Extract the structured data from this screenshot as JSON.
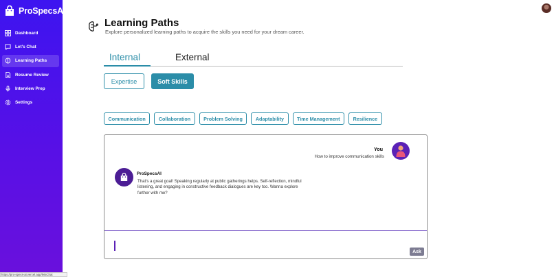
{
  "app": {
    "name": "ProSpecsAI"
  },
  "sidebar": {
    "items": [
      {
        "label": "Dashboard",
        "icon": "dashboard-icon",
        "active": false
      },
      {
        "label": "Let's Chat",
        "icon": "chat-icon",
        "active": false
      },
      {
        "label": "Learning Paths",
        "icon": "brain-icon",
        "active": true
      },
      {
        "label": "Resume Review",
        "icon": "document-icon",
        "active": false
      },
      {
        "label": "Interview Prep",
        "icon": "microphone-icon",
        "active": false
      },
      {
        "label": "Settings",
        "icon": "gear-icon",
        "active": false
      }
    ]
  },
  "status_bar": {
    "url": "https://pro-specs-ai.vercel.app/letsChat"
  },
  "header": {
    "title": "Learning Paths",
    "subtitle": "Explore personalized learning paths to acquire the skills you need for your dream career."
  },
  "tabs": [
    {
      "label": "Internal",
      "active": true
    },
    {
      "label": "External",
      "active": false
    }
  ],
  "categories": [
    {
      "label": "Expertise",
      "selected": false
    },
    {
      "label": "Soft Skills",
      "selected": true
    }
  ],
  "skills": [
    "Communication",
    "Collaboration",
    "Problem Solving",
    "Adaptability",
    "Time Management",
    "Resilience"
  ],
  "chat": {
    "user": {
      "name": "You",
      "message": "How to improve communication skills"
    },
    "bot": {
      "name": "ProSpecsAI",
      "message": "That's a great goal! Speaking regularly at public gatherings helps. Self-reflection, mindful listening, and engaging in constructive feedback dialogues are key too. Wanna explore further with me?"
    },
    "input_value": "",
    "ask_label": "Ask"
  },
  "colors": {
    "sidebar_start": "#3d14f0",
    "sidebar_end": "#6a10dc",
    "accent": "#2b8da8",
    "bot_avatar": "#4c1d95"
  }
}
